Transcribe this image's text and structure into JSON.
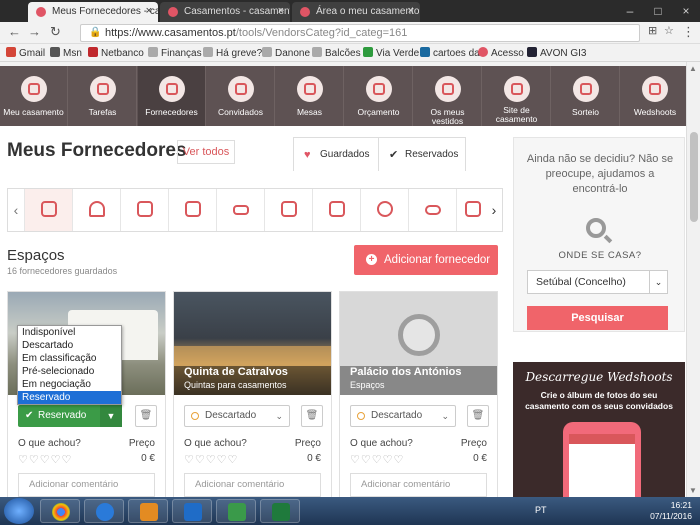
{
  "browser": {
    "tabs": [
      {
        "title": "Meus Fornecedores - ca",
        "active": true
      },
      {
        "title": "Casamentos - casament",
        "active": false
      },
      {
        "title": "Área o meu casamento",
        "active": false
      }
    ],
    "url_host": "https://www.casamentos.pt",
    "url_path": "/tools/VendorsCateg?id_categ=161",
    "bookmarks": [
      "Gmail",
      "Msn",
      "Netbanco",
      "Finanças",
      "Há greve?",
      "Danone",
      "Balcões",
      "Via Verde",
      "cartoes da",
      "Acesso",
      "AVON GI3"
    ]
  },
  "nav": {
    "items": [
      "Meu casamento",
      "Tarefas",
      "Fornecedores",
      "Convidados",
      "Mesas",
      "Orçamento",
      "Os meus vestidos",
      "Site de casamento",
      "Sorteio",
      "Wedshoots"
    ]
  },
  "page": {
    "title": "Meus Fornecedores",
    "ver_todos": "Ver todos",
    "tab_guardados": "Guardados",
    "tab_reservados": "Reservados",
    "section_title": "Espaços",
    "section_count": "16 fornecedores guardados",
    "add_button": "Adicionar fornecedor"
  },
  "cards": [
    {
      "name": "",
      "subtitle": "",
      "status": "Reservado",
      "rating_label": "O que achou?",
      "price_label": "Preço",
      "price": "0 €",
      "comment_placeholder": "Adicionar comentário"
    },
    {
      "name": "Quinta de Catralvos",
      "subtitle": "Quintas para casamentos",
      "status": "Descartado",
      "rating_label": "O que achou?",
      "price_label": "Preço",
      "price": "0 €",
      "comment_placeholder": "Adicionar comentário"
    },
    {
      "name": "Palácio dos Antónios",
      "subtitle": "Espaços",
      "status": "Descartado",
      "rating_label": "O que achou?",
      "price_label": "Preço",
      "price": "0 €",
      "comment_placeholder": "Adicionar comentário"
    }
  ],
  "status_dropdown": {
    "options": [
      "Indisponível",
      "Descartado",
      "Em classificação",
      "Pré-selecionado",
      "Em negociação",
      "Reservado"
    ],
    "selected": "Reservado"
  },
  "sidebar": {
    "prompt": "Ainda não se decidiu? Não se preocupe, ajudamos a encontrá-lo",
    "where_label": "ONDE SE CASA?",
    "location_value": "Setúbal (Concelho)",
    "search_button": "Pesquisar",
    "promo_title": "Descarregue Wedshoots",
    "promo_text": "Crie o álbum de fotos do seu casamento com os seus convidados"
  },
  "taskbar": {
    "language": "PT",
    "time": "16:21",
    "date": "07/11/2016"
  },
  "colors": {
    "accent": "#f0646a",
    "nav_bg": "#5e5253",
    "reserved_green": "#3b9b47"
  }
}
